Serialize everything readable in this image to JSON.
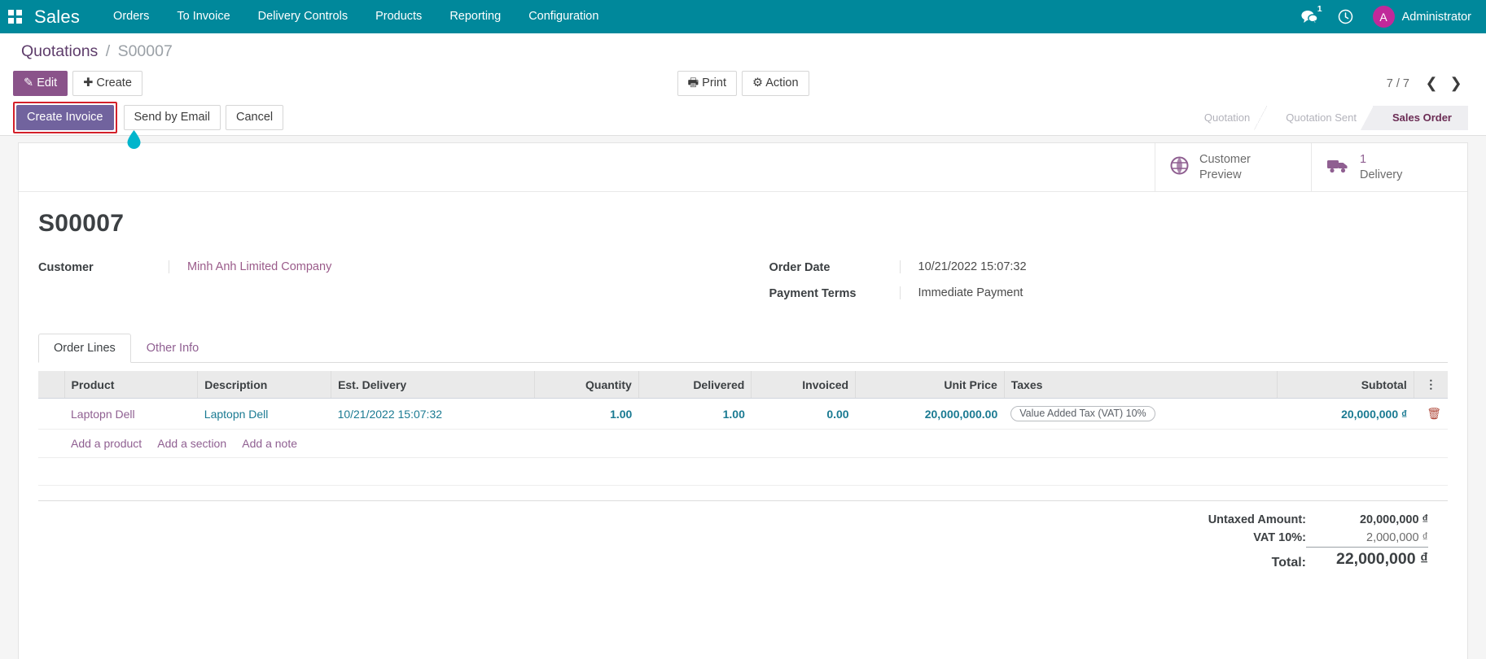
{
  "navbar": {
    "apps_icon": "apps-grid-icon",
    "brand": "Sales",
    "menu": [
      {
        "label": "Orders"
      },
      {
        "label": "To Invoice"
      },
      {
        "label": "Delivery Controls"
      },
      {
        "label": "Products"
      },
      {
        "label": "Reporting"
      },
      {
        "label": "Configuration"
      }
    ],
    "messages_icon": "messages-icon",
    "messages_count": "1",
    "activity_icon": "clock-icon",
    "avatar_initial": "A",
    "user_name": "Administrator"
  },
  "breadcrumb": {
    "root": "Quotations",
    "separator": "/",
    "current": "S00007"
  },
  "control_panel": {
    "edit_label": "Edit",
    "create_label": "Create",
    "print_label": "Print",
    "action_label": "Action",
    "pager_value": "7 / 7",
    "prev_icon": "chevron-left-icon",
    "next_icon": "chevron-right-icon",
    "create_invoice_label": "Create Invoice",
    "send_by_email_label": "Send by Email",
    "cancel_label": "Cancel"
  },
  "status_bar": {
    "steps": [
      {
        "label": "Quotation",
        "active": false
      },
      {
        "label": "Quotation Sent",
        "active": false
      },
      {
        "label": "Sales Order",
        "active": true
      }
    ]
  },
  "smart_buttons": [
    {
      "icon": "globe-icon",
      "line1": "Customer",
      "line2": "Preview"
    },
    {
      "icon": "truck-icon",
      "line1": "1",
      "line2": "Delivery"
    }
  ],
  "form": {
    "record_title": "S00007",
    "customer_label": "Customer",
    "customer_value": "Minh Anh Limited Company",
    "order_date_label": "Order Date",
    "order_date_value": "10/21/2022 15:07:32",
    "payment_terms_label": "Payment Terms",
    "payment_terms_value": "Immediate Payment"
  },
  "notebook": {
    "tabs": [
      {
        "label": "Order Lines",
        "active": true
      },
      {
        "label": "Other Info",
        "active": false
      }
    ]
  },
  "lines_table": {
    "headers": {
      "product": "Product",
      "description": "Description",
      "est_delivery": "Est. Delivery",
      "quantity": "Quantity",
      "delivered": "Delivered",
      "invoiced": "Invoiced",
      "unit_price": "Unit Price",
      "taxes": "Taxes",
      "subtotal": "Subtotal",
      "options_icon": "options-vertical-dots-icon"
    },
    "rows": [
      {
        "product": "Laptopn Dell",
        "description": "Laptopn Dell",
        "est_delivery": "10/21/2022 15:07:32",
        "quantity": "1.00",
        "delivered": "1.00",
        "invoiced": "0.00",
        "unit_price": "20,000,000.00",
        "taxes": "Value Added Tax (VAT) 10%",
        "subtotal": "20,000,000 ₫",
        "delete_icon": "trash-icon"
      }
    ],
    "add_links": [
      {
        "label": "Add a product"
      },
      {
        "label": "Add a section"
      },
      {
        "label": "Add a note"
      }
    ]
  },
  "totals": {
    "untaxed_label": "Untaxed Amount:",
    "untaxed_value": "20,000,000 ₫",
    "tax_label": "VAT 10%:",
    "tax_value": "2,000,000 ₫",
    "total_label": "Total:",
    "total_value": "22,000,000 ₫"
  },
  "colors": {
    "navbar": "#00889b",
    "primary_button": "#71639e",
    "edit_button": "#8a538a",
    "highlight_border": "#d3202a",
    "link_purple": "#8f5f91",
    "link_teal": "#1a7a92",
    "avatar": "#c0299a"
  }
}
